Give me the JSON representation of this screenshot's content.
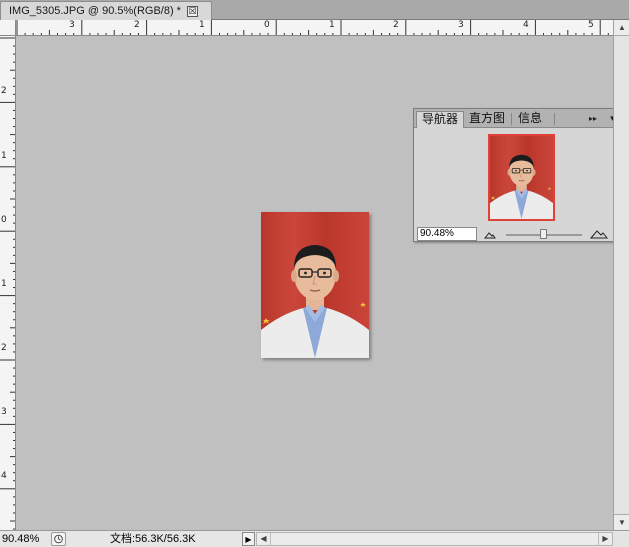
{
  "document_tab": {
    "title": "IMG_5305.JPG @ 90.5%(RGB/8) *",
    "close_symbol": "☒"
  },
  "rulers": {
    "top_labels": [
      "3",
      "2",
      "1",
      "0",
      "1",
      "2",
      "3",
      "4",
      "5",
      "6"
    ],
    "left_labels": [
      "2",
      "1",
      "0",
      "1",
      "2",
      "3",
      "4"
    ]
  },
  "navigator": {
    "tabs": [
      "导航器",
      "直方图",
      "信息"
    ],
    "collapse_symbol": "▸▸",
    "menu_symbol": "▾≡",
    "zoom_value": "90.48%"
  },
  "status_bar": {
    "zoom": "90.48%",
    "doc_info": "文档:56.3K/56.3K",
    "arrow_symbol": "▶"
  },
  "colors": {
    "canvas_bg": "#c0c0c0",
    "photo_red": "#cc3b2e",
    "coat_white": "#e8e8e8",
    "shirt_blue": "#8fa8d6"
  },
  "icons": [
    "close-icon",
    "history-icon",
    "small-mountain-icon",
    "large-mountain-icon",
    "resize-grip-icon",
    "scroll-up-icon",
    "scroll-down-icon",
    "scroll-left-icon",
    "scroll-right-icon"
  ]
}
